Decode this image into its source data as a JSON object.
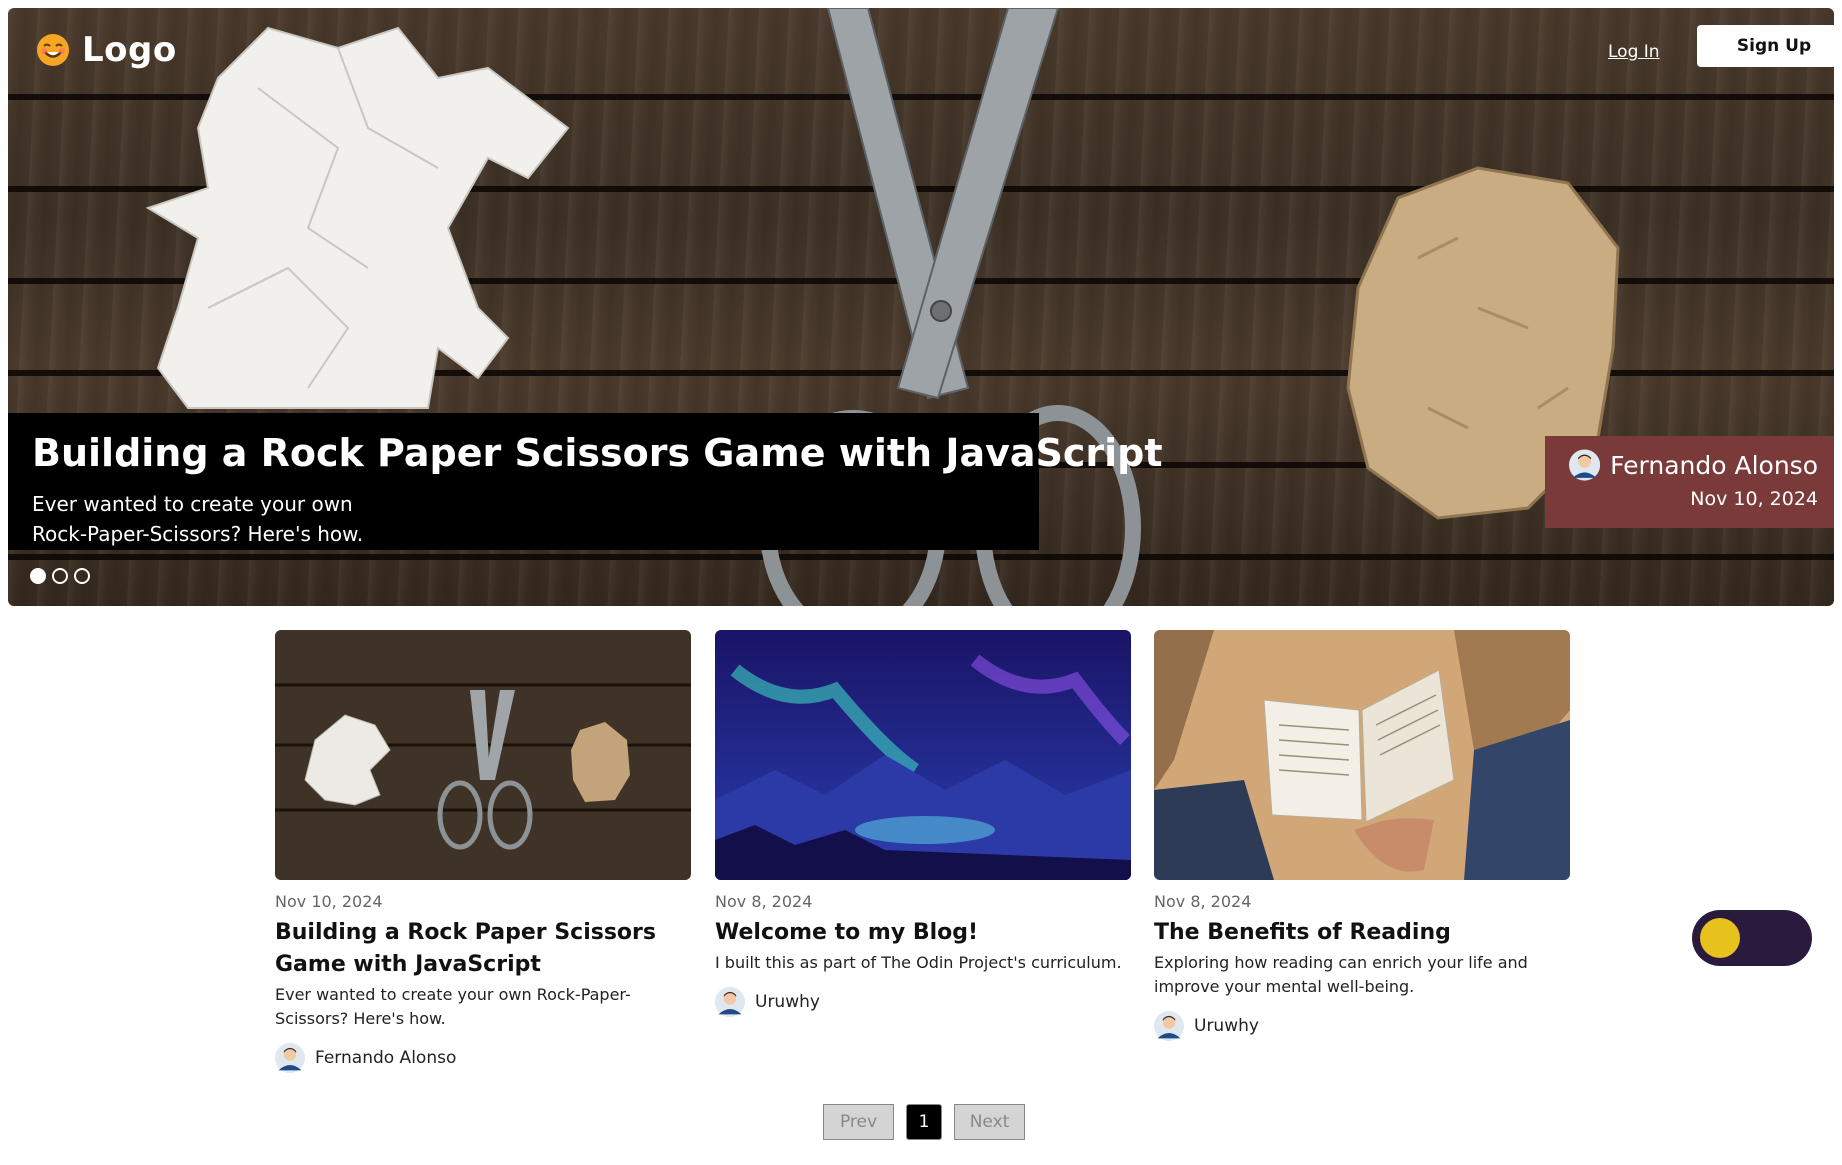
{
  "nav": {
    "brand": "Logo",
    "login_label": "Log In",
    "signup_label": "Sign Up"
  },
  "hero": {
    "title": "Building a Rock Paper Scissors Game with JavaScript",
    "excerpt": "Ever wanted to create your own Rock-Paper-Scissors? Here's how.",
    "author": "Fernando Alonso",
    "date": "Nov 10, 2024",
    "slide_count": 3,
    "active_slide": 1
  },
  "posts": [
    {
      "date": "Nov 10, 2024",
      "title": "Building a Rock Paper Scissors Game with JavaScript",
      "excerpt": "Ever wanted to create your own Rock-Paper-Scissors? Here's how.",
      "author": "Fernando Alonso",
      "image": "rock-paper-scissors"
    },
    {
      "date": "Nov 8, 2024",
      "title": "Welcome to my Blog!",
      "excerpt": "I built this as part of The Odin Project's curriculum.",
      "author": "Uruwhy",
      "image": "aurora-landscape"
    },
    {
      "date": "Nov 8, 2024",
      "title": "The Benefits of Reading",
      "excerpt": "Exploring how reading can enrich your life and improve your mental well-being.",
      "author": "Uruwhy",
      "image": "open-book"
    }
  ],
  "pagination": {
    "prev_label": "Prev",
    "current_page": "1",
    "next_label": "Next"
  },
  "theme_toggle": {
    "state": "dark"
  },
  "colors": {
    "hero_overlay": "#000000",
    "author_badge": "#7b3a3a",
    "toggle_bg": "#2a1a3e",
    "toggle_knob": "#e7c21c",
    "active_page": "#000000"
  }
}
